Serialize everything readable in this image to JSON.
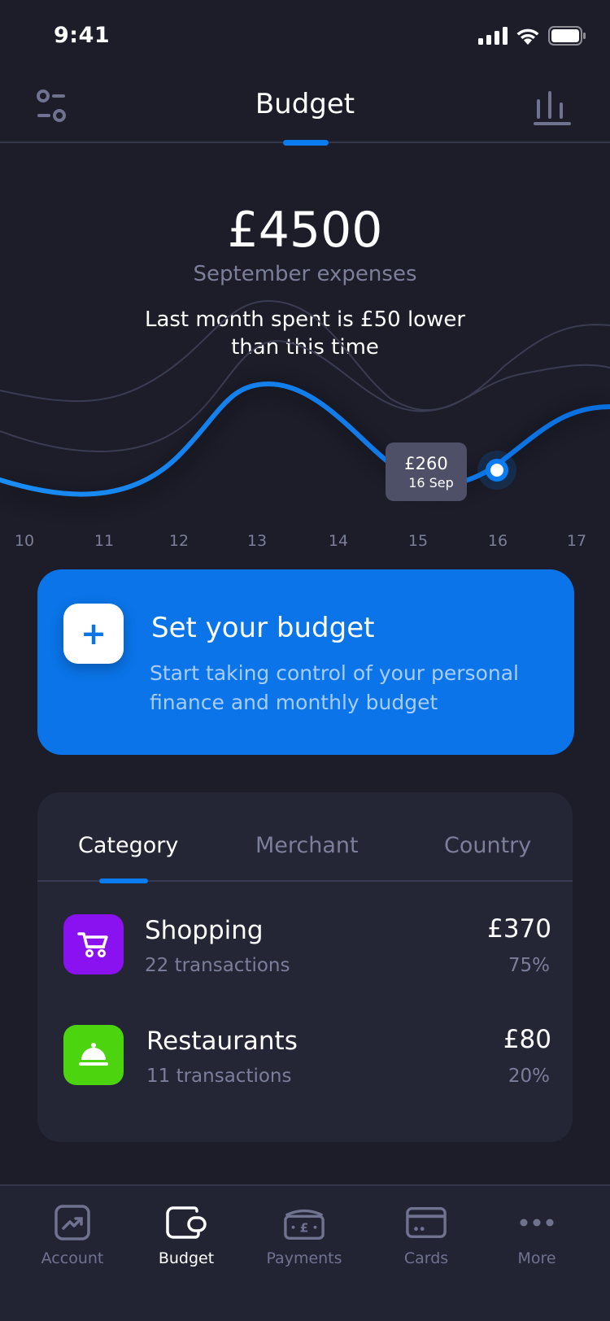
{
  "status": {
    "time": "9:41"
  },
  "header": {
    "title": "Budget"
  },
  "summary": {
    "amount": "£4500",
    "subtitle": "September expenses",
    "comparison_line1": "Last month spent is £50 lower",
    "comparison_line2": "than this time"
  },
  "chart_data": {
    "type": "line",
    "categories": [
      "10",
      "11",
      "12",
      "13",
      "14",
      "15",
      "16",
      "17"
    ],
    "tooltip": {
      "value": "£260",
      "date": "16 Sep"
    },
    "selected_category": "16"
  },
  "budget_card": {
    "title": "Set your budget",
    "description": "Start taking control of your personal finance and monthly budget",
    "plus_symbol": "+"
  },
  "tabs": [
    {
      "label": "Category",
      "active": true
    },
    {
      "label": "Merchant",
      "active": false
    },
    {
      "label": "Country",
      "active": false
    }
  ],
  "categories": [
    {
      "name": "Shopping",
      "count": "22 transactions",
      "amount": "£370",
      "percent": "75%",
      "color": "#8b12f0",
      "icon": "shopping-cart-icon"
    },
    {
      "name": "Restaurants",
      "count": "11 transactions",
      "amount": "£80",
      "percent": "20%",
      "color": "#4cd40e",
      "icon": "cloche-icon"
    }
  ],
  "nav": [
    {
      "label": "Account",
      "icon": "account-icon",
      "active": false
    },
    {
      "label": "Budget",
      "icon": "wallet-icon",
      "active": true
    },
    {
      "label": "Payments",
      "icon": "payments-icon",
      "active": false
    },
    {
      "label": "Cards",
      "icon": "card-icon",
      "active": false
    },
    {
      "label": "More",
      "icon": "more-icon",
      "active": false
    }
  ],
  "colors": {
    "background": "#1c1d29",
    "accent": "#0a7cf0",
    "card": "#242636",
    "muted": "#7b7f99"
  }
}
